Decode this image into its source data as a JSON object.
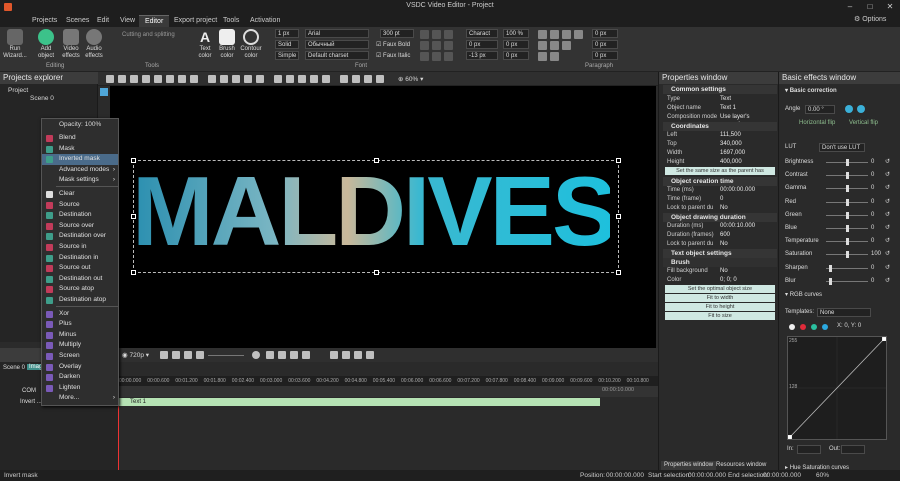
{
  "window": {
    "title": "VSDC Video Editor - Project"
  },
  "top_right": {
    "options_label": "Options"
  },
  "menu": [
    "Projects",
    "Scenes",
    "Edit",
    "View",
    "Editor",
    "Export project",
    "Tools",
    "Activation"
  ],
  "ribbon": {
    "run_wizard": "Run Wizard...",
    "add_object": "Add object",
    "video_effects": "Video effects",
    "audio_effects": "Audio effects",
    "group_editing": "Editing",
    "cutting": "Cutting and splitting",
    "group_tools": "Tools",
    "text_color": "Text color",
    "brush_color": "Brush color",
    "contour_color": "Contour color",
    "group_font": "Font",
    "group_paragraph": "Paragraph",
    "line_width": "1 px",
    "line_style": "Solid",
    "line_type": "Simple",
    "font_name": "Arial",
    "font_style": "Обычный",
    "charset": "Default charset",
    "font_size": "300 pt",
    "faux_bold": "Faux Bold",
    "faux_italic": "Faux Italic",
    "charact": "Charact",
    "char_pct": "100 %",
    "spacing_a": "0 px",
    "spacing_b": "0 px",
    "spacing_c": "-13 px",
    "spacing_d": "0 px",
    "para_a": "0 px",
    "para_b": "0 px",
    "para_c": "0 px"
  },
  "toolbar2": {
    "zoom": "60%"
  },
  "projects_explorer": {
    "title": "Projects explorer",
    "project": "Project",
    "scene": "Scene 0"
  },
  "context_menu": {
    "opacity": "Opacity: 100%",
    "items": [
      "Blend",
      "Mask",
      "Inverted mask",
      "Advanced modes",
      "Mask settings",
      "Clear",
      "Source",
      "Destination",
      "Source over",
      "Destination over",
      "Source in",
      "Destination in",
      "Source out",
      "Destination out",
      "Source atop",
      "Destination atop",
      "Xor",
      "Plus",
      "Minus",
      "Multiply",
      "Screen",
      "Overlay",
      "Darken",
      "Lighten",
      "More..."
    ]
  },
  "preview": {
    "text": "MALDIVES"
  },
  "properties": {
    "title": "Properties window",
    "common": "Common settings",
    "rows": [
      {
        "k": "Type",
        "v": "Text"
      },
      {
        "k": "Object name",
        "v": "Text 1"
      },
      {
        "k": "Composition mode",
        "v": "Use layer's properties"
      }
    ],
    "coords_title": "Coordinates",
    "coords": [
      {
        "k": "Left",
        "v": "111,500"
      },
      {
        "k": "Top",
        "v": "340,000"
      },
      {
        "k": "Width",
        "v": "1697,000"
      },
      {
        "k": "Height",
        "v": "400,000"
      }
    ],
    "same_size": "Set the same size as the parent has",
    "creation_title": "Object creation time",
    "creation": [
      {
        "k": "Time (ms)",
        "v": "00:00:00.000"
      },
      {
        "k": "Time (frame)",
        "v": "0"
      },
      {
        "k": "Lock to parent du",
        "v": "No"
      }
    ],
    "duration_title": "Object drawing duration",
    "duration": [
      {
        "k": "Duration (ms)",
        "v": "00:00:10.000"
      },
      {
        "k": "Duration (frames)",
        "v": "600"
      },
      {
        "k": "Lock to parent du",
        "v": "No"
      }
    ],
    "text_title": "Text object settings",
    "brush_title": "Brush",
    "brush": [
      {
        "k": "Fill background",
        "v": "No"
      },
      {
        "k": "Color",
        "v": "0; 0; 0"
      }
    ],
    "buttons": [
      "Set the optimal object size",
      "Fit to width",
      "Fit to height",
      "Fit to size"
    ],
    "tab_props": "Properties window",
    "tab_resources": "Resources window"
  },
  "effects": {
    "title": "Basic effects window",
    "basic_correction": "Basic correction",
    "angle_label": "Angle",
    "angle_value": "0.00 °",
    "hflip": "Horizontal flip",
    "vflip": "Vertical flip",
    "lut_label": "LUT",
    "lut_value": "Don't use LUT",
    "sliders": [
      {
        "name": "Brightness",
        "value": "0",
        "level": 0.5
      },
      {
        "name": "Contrast",
        "value": "0",
        "level": 0.5
      },
      {
        "name": "Gamma",
        "value": "0",
        "level": 0.5
      },
      {
        "name": "Red",
        "value": "0",
        "level": 0.5
      },
      {
        "name": "Green",
        "value": "0",
        "level": 0.5
      },
      {
        "name": "Blue",
        "value": "0",
        "level": 0.5
      },
      {
        "name": "Temperature",
        "value": "0",
        "level": 0.5
      },
      {
        "name": "Saturation",
        "value": "100",
        "level": 0.5
      },
      {
        "name": "Sharpen",
        "value": "0",
        "level": 0.1
      },
      {
        "name": "Blur",
        "value": "0",
        "level": 0.1
      }
    ],
    "rgb_curves": "RGB curves",
    "templates_label": "Templates:",
    "templates_value": "None",
    "xy": "X: 0, Y: 0",
    "curve_top": "255",
    "curve_mid": "128",
    "in_label": "In:",
    "out_label": "Out:",
    "hue_sat": "Hue Saturation curves"
  },
  "timeline": {
    "resolution": "720p",
    "scene_tab": "Scene 0",
    "image_tab": "Imag",
    "ruler": [
      "00:00.000",
      "00:00.600",
      "00:01.200",
      "00:01.800",
      "00:02.400",
      "00:03.000",
      "00:03.600",
      "00:04.200",
      "00:04.800",
      "00:05.400",
      "00:06.000",
      "00:06.600",
      "00:07.200",
      "00:07.800",
      "00:08.400",
      "00:09.000",
      "00:09.600",
      "00:10.200",
      "00:10.800"
    ],
    "clip_label": "Text 1",
    "clip_end": "00:00:10.000",
    "layer_com": "COM",
    "layer_invert": "Invert ..."
  },
  "status": {
    "left": "Invert mask",
    "position_label": "Position:",
    "position": "00:00:00.000",
    "start_label": "Start selection:",
    "start": "00:00:00.000",
    "end_label": "End selection:",
    "end": "00:00:00.000",
    "zoom": "60%"
  }
}
